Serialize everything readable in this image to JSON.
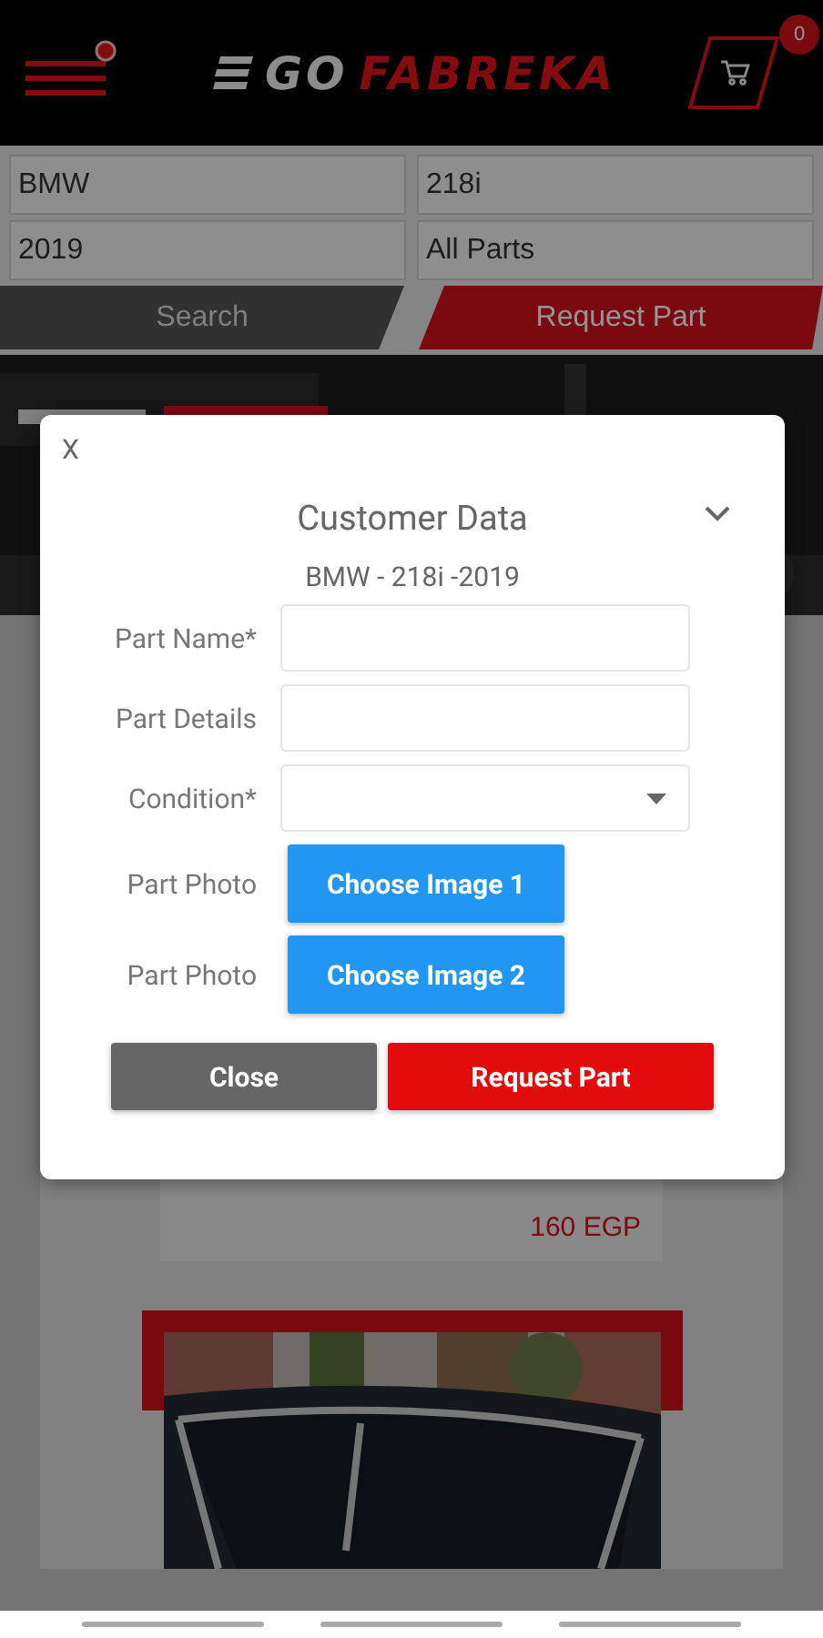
{
  "header": {
    "logo": {
      "part_1": "GO",
      "part_2": "FABREKA"
    },
    "menu_notification": true,
    "cart_count": "0"
  },
  "filters": [
    {
      "value": "BMW"
    },
    {
      "value": "218i"
    },
    {
      "value": "2019"
    },
    {
      "value": "All Parts"
    }
  ],
  "actions": [
    {
      "label": "Search",
      "kind": "secondary"
    },
    {
      "label": "Request Part",
      "kind": "primary"
    }
  ],
  "product": {
    "price": "160 EGP"
  },
  "dialog": {
    "close_label": "X",
    "title": "Customer Data",
    "subtitle": "BMW - 218i -2019",
    "fields": [
      {
        "label": "Part Name*",
        "kind": "text"
      },
      {
        "label": "Part Details",
        "kind": "text"
      },
      {
        "label": "Condition*",
        "kind": "select"
      },
      {
        "label": "Part Photo",
        "kind": "file",
        "button": "Choose Image 1"
      },
      {
        "label": "Part Photo",
        "kind": "file",
        "button": "Choose Image 2"
      }
    ],
    "buttons": [
      {
        "label": "Close",
        "kind": "secondary"
      },
      {
        "label": "Request Part",
        "kind": "primary"
      }
    ]
  }
}
